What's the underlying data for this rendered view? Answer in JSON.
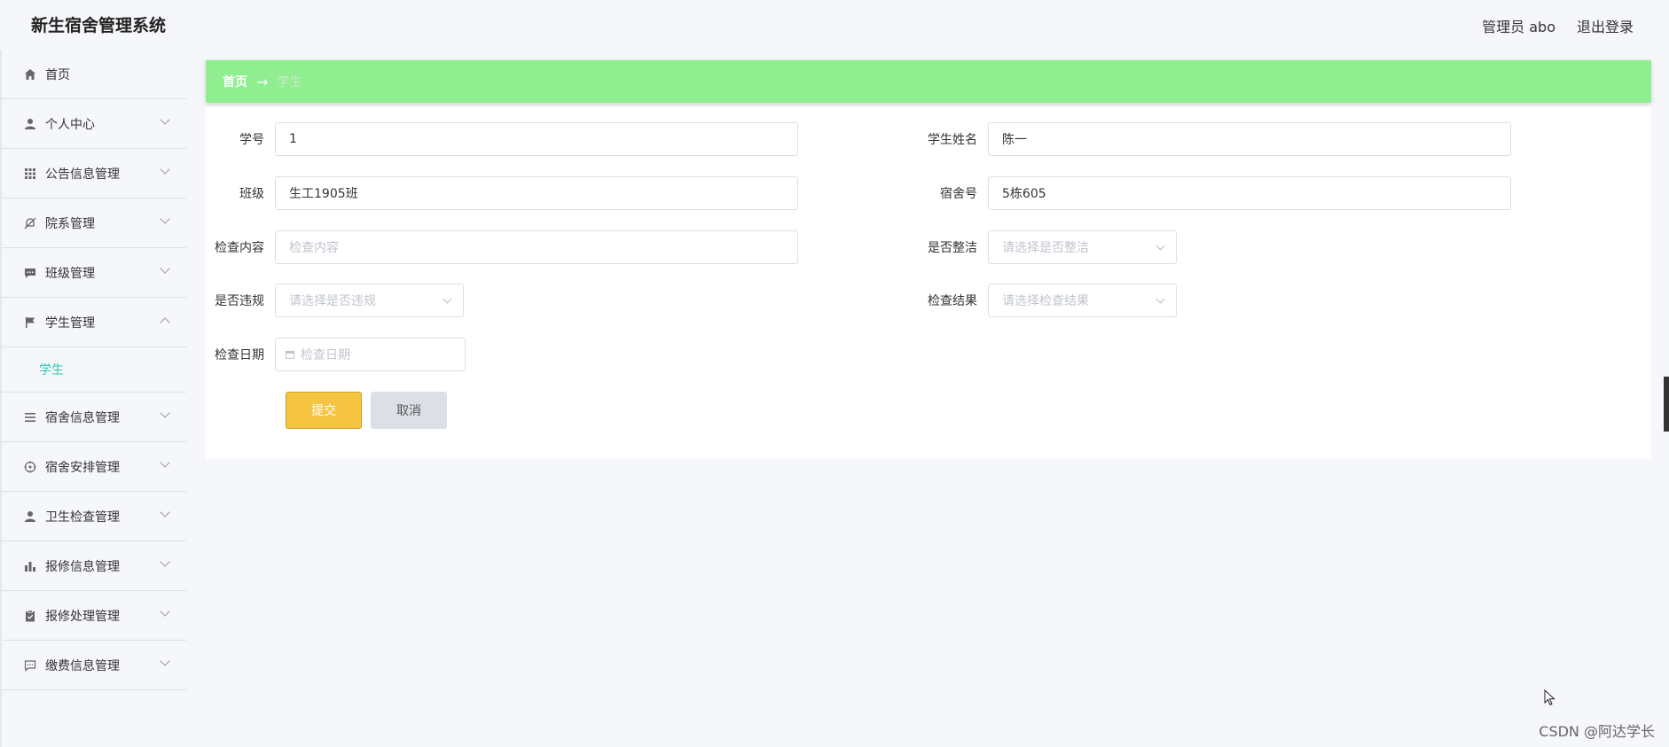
{
  "header": {
    "title": "新生宿舍管理系统",
    "user": "管理员 abo",
    "logout": "退出登录"
  },
  "sidebar": {
    "items": [
      {
        "label": "首页",
        "icon": "home-icon",
        "arrow": "none"
      },
      {
        "label": "个人中心",
        "icon": "user-icon",
        "arrow": "down"
      },
      {
        "label": "公告信息管理",
        "icon": "grid-icon",
        "arrow": "down"
      },
      {
        "label": "院系管理",
        "icon": "bell-off-icon",
        "arrow": "down"
      },
      {
        "label": "班级管理",
        "icon": "chat-icon",
        "arrow": "down"
      },
      {
        "label": "学生管理",
        "icon": "flag-icon",
        "arrow": "up"
      },
      {
        "label": "宿舍信息管理",
        "icon": "menu-icon",
        "arrow": "down"
      },
      {
        "label": "宿舍安排管理",
        "icon": "target-icon",
        "arrow": "down"
      },
      {
        "label": "卫生检查管理",
        "icon": "user-icon",
        "arrow": "down"
      },
      {
        "label": "报修信息管理",
        "icon": "bar-chart-icon",
        "arrow": "down"
      },
      {
        "label": "报修处理管理",
        "icon": "clipboard-icon",
        "arrow": "down"
      },
      {
        "label": "缴费信息管理",
        "icon": "message-icon",
        "arrow": "down"
      }
    ],
    "sub_item": "学生"
  },
  "breadcrumb": {
    "home": "首页",
    "arrow": "→",
    "current": "学生"
  },
  "form": {
    "student_no_label": "学号",
    "student_no_value": "1",
    "student_name_label": "学生姓名",
    "student_name_value": "陈一",
    "class_label": "班级",
    "class_value": "生工1905班",
    "dorm_no_label": "宿舍号",
    "dorm_no_value": "5栋605",
    "content_label": "检查内容",
    "content_placeholder": "检查内容",
    "clean_label": "是否整洁",
    "clean_placeholder": "请选择是否整洁",
    "violation_label": "是否违规",
    "violation_placeholder": "请选择是否违规",
    "result_label": "检查结果",
    "result_placeholder": "请选择检查结果",
    "date_label": "检查日期",
    "date_placeholder": "检查日期",
    "submit": "提交",
    "cancel": "取消"
  },
  "watermark": "CSDN @阿达学长",
  "colors": {
    "breadcrumb_bg": "#90ee90",
    "submit_bg": "#f5c542",
    "active_sub": "#2ec7b6"
  }
}
